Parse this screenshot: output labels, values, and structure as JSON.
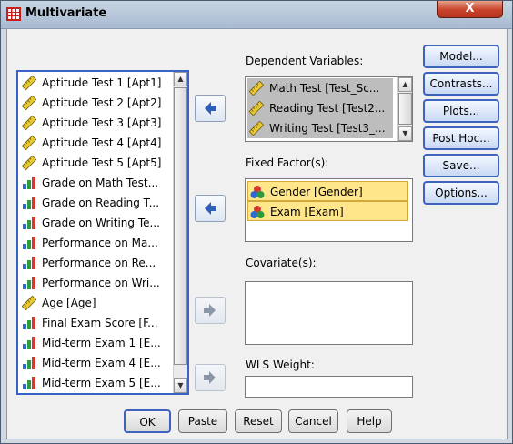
{
  "window": {
    "title": "Multivariate",
    "close_glyph": "X"
  },
  "source_list": {
    "items": [
      {
        "label": "Aptitude Test 1 [Apt1]",
        "icon": "ruler-icon"
      },
      {
        "label": "Aptitude Test 2 [Apt2]",
        "icon": "ruler-icon"
      },
      {
        "label": "Aptitude Test 3 [Apt3]",
        "icon": "ruler-icon"
      },
      {
        "label": "Aptitude Test 4 [Apt4]",
        "icon": "ruler-icon"
      },
      {
        "label": "Aptitude Test 5 [Apt5]",
        "icon": "ruler-icon"
      },
      {
        "label": "Grade on Math Test...",
        "icon": "bar-chart-icon"
      },
      {
        "label": "Grade on Reading T...",
        "icon": "bar-chart-icon"
      },
      {
        "label": "Grade on Writing Te...",
        "icon": "bar-chart-icon"
      },
      {
        "label": "Performance on Ma...",
        "icon": "bar-chart-icon"
      },
      {
        "label": "Performance on Re...",
        "icon": "bar-chart-icon"
      },
      {
        "label": "Performance on Wri...",
        "icon": "bar-chart-icon"
      },
      {
        "label": "Age [Age]",
        "icon": "ruler-icon"
      },
      {
        "label": "Final Exam Score [F...",
        "icon": "bar-chart-icon"
      },
      {
        "label": "Mid-term Exam 1 [E...",
        "icon": "bar-chart-icon"
      },
      {
        "label": "Mid-term Exam 4 [E...",
        "icon": "bar-chart-icon"
      },
      {
        "label": "Mid-term Exam 5 [E...",
        "icon": "bar-chart-icon"
      }
    ]
  },
  "dependent": {
    "label": "Dependent Variables:",
    "items": [
      {
        "label": "Math Test [Test_Sc...",
        "icon": "ruler-icon"
      },
      {
        "label": "Reading Test [Test2...",
        "icon": "ruler-icon"
      },
      {
        "label": "Writing Test [Test3_...",
        "icon": "ruler-icon"
      }
    ]
  },
  "fixed": {
    "label": "Fixed Factor(s):",
    "items": [
      {
        "label": "Gender [Gender]",
        "icon": "nominal-icon"
      },
      {
        "label": "Exam [Exam]",
        "icon": "nominal-icon"
      }
    ]
  },
  "covariate": {
    "label": "Covariate(s):"
  },
  "wls": {
    "label": "WLS Weight:"
  },
  "side_buttons": [
    "Model...",
    "Contrasts...",
    "Plots...",
    "Post Hoc...",
    "Save...",
    "Options..."
  ],
  "bottom_buttons": [
    "OK",
    "Paste",
    "Reset",
    "Cancel",
    "Help"
  ],
  "colors": {
    "focus_blue": "#3a63c7",
    "selected_yellow": "#ffe68a",
    "arrow_blue": "#2e5fb8",
    "close_red": "#c9432b"
  }
}
